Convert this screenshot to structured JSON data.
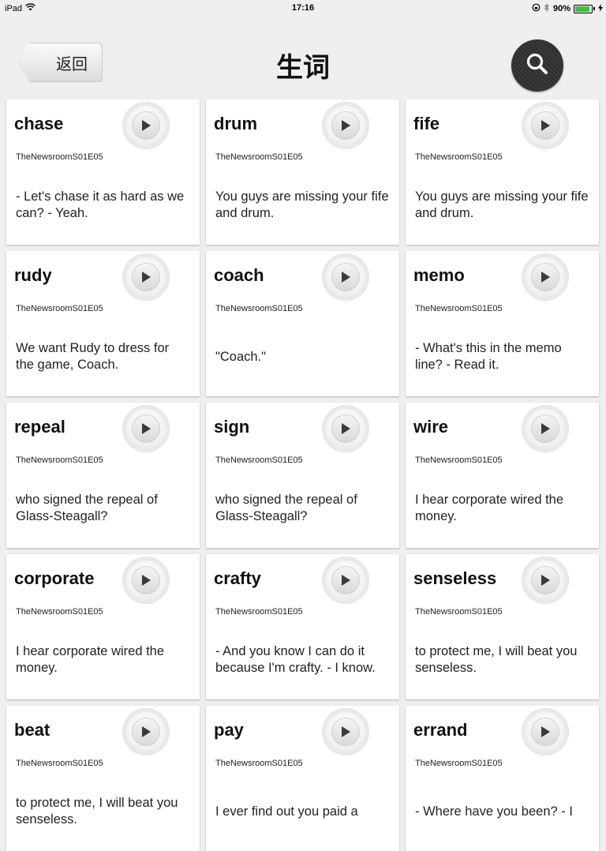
{
  "status_bar": {
    "device": "iPad",
    "time": "17:16",
    "battery_percent": "90%",
    "battery_level": 0.9,
    "icons": [
      "wifi-icon",
      "orientation-lock-icon",
      "bluetooth-icon",
      "battery-icon",
      "charging-icon"
    ]
  },
  "nav": {
    "back_label": "返回",
    "title": "生词",
    "search_icon": "search-icon"
  },
  "cards": [
    {
      "word": "chase",
      "source": "TheNewsroomS01E05",
      "sentence": "- Let's chase it as hard as we can? - Yeah."
    },
    {
      "word": "drum",
      "source": "TheNewsroomS01E05",
      "sentence": "You guys are missing your fife and drum."
    },
    {
      "word": "fife",
      "source": "TheNewsroomS01E05",
      "sentence": "You guys are missing your fife and drum."
    },
    {
      "word": "rudy",
      "source": "TheNewsroomS01E05",
      "sentence": "We want Rudy to dress for the game, Coach."
    },
    {
      "word": "coach",
      "source": "TheNewsroomS01E05",
      "sentence": "\"Coach.\""
    },
    {
      "word": "memo",
      "source": "TheNewsroomS01E05",
      "sentence": "- What's this in the memo line? - Read it."
    },
    {
      "word": "repeal",
      "source": "TheNewsroomS01E05",
      "sentence": "who signed the repeal of Glass-Steagall?"
    },
    {
      "word": "sign",
      "source": "TheNewsroomS01E05",
      "sentence": "who signed the repeal of Glass-Steagall?"
    },
    {
      "word": "wire",
      "source": "TheNewsroomS01E05",
      "sentence": "I hear corporate wired the money."
    },
    {
      "word": "corporate",
      "source": "TheNewsroomS01E05",
      "sentence": "I hear corporate wired the money."
    },
    {
      "word": "crafty",
      "source": "TheNewsroomS01E05",
      "sentence": "- And you know I can do it because I'm crafty. - I know."
    },
    {
      "word": "senseless",
      "source": "TheNewsroomS01E05",
      "sentence": "to protect me, I will beat you senseless."
    },
    {
      "word": "beat",
      "source": "TheNewsroomS01E05",
      "sentence": "to protect me, I will beat you senseless."
    },
    {
      "word": "pay",
      "source": "TheNewsroomS01E05",
      "sentence": "I ever find out you paid a"
    },
    {
      "word": "errand",
      "source": "TheNewsroomS01E05",
      "sentence": "- Where have you been? - I"
    }
  ]
}
